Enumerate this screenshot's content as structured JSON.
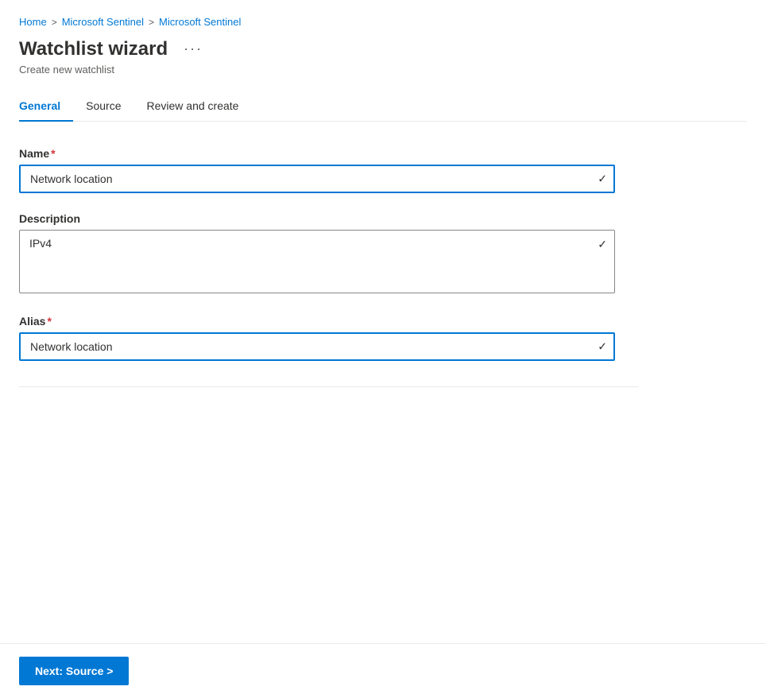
{
  "breadcrumb": {
    "items": [
      {
        "label": "Home",
        "href": "#"
      },
      {
        "label": "Microsoft Sentinel",
        "href": "#"
      },
      {
        "label": "Microsoft Sentinel",
        "href": "#"
      }
    ],
    "separator": ">"
  },
  "header": {
    "title": "Watchlist wizard",
    "more_options_label": "···",
    "subtitle": "Create new watchlist"
  },
  "tabs": [
    {
      "label": "General",
      "active": true
    },
    {
      "label": "Source",
      "active": false
    },
    {
      "label": "Review and create",
      "active": false
    }
  ],
  "form": {
    "name_label": "Name",
    "name_value": "Network location",
    "description_label": "Description",
    "description_value": "IPv4",
    "alias_label": "Alias",
    "alias_value": "Network location"
  },
  "footer": {
    "next_button_label": "Next: Source >"
  }
}
